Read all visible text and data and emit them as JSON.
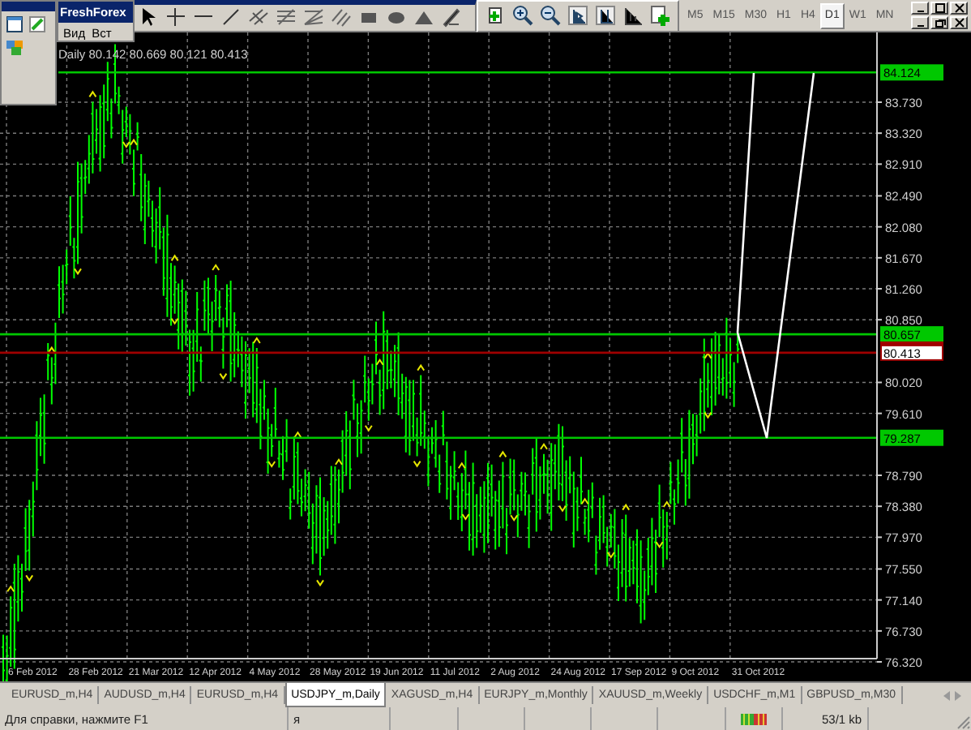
{
  "app": {
    "title": "FreshForex",
    "menu": [
      "Вид",
      "Вст"
    ]
  },
  "timeframes": [
    {
      "label": "M5",
      "selected": false
    },
    {
      "label": "M15",
      "selected": false
    },
    {
      "label": "M30",
      "selected": false
    },
    {
      "label": "H1",
      "selected": false
    },
    {
      "label": "H4",
      "selected": false
    },
    {
      "label": "D1",
      "selected": true
    },
    {
      "label": "W1",
      "selected": false
    },
    {
      "label": "MN",
      "selected": false
    }
  ],
  "chart": {
    "ohlc_text": "Daily 80.142 80.669 80.121 80.413",
    "price_ticks": [
      "83.730",
      "83.320",
      "82.910",
      "82.490",
      "82.080",
      "81.670",
      "81.260",
      "80.850",
      "80.020",
      "79.610",
      "78.790",
      "78.380",
      "77.970",
      "77.550",
      "77.140",
      "76.730",
      "76.320"
    ],
    "levels": [
      {
        "label": "84.124",
        "kind": "level",
        "color": "#00c800"
      },
      {
        "label": "80.657",
        "kind": "level",
        "color": "#00c800"
      },
      {
        "label": "80.413",
        "kind": "bid",
        "color": "#a00000"
      },
      {
        "label": "79.287",
        "kind": "level",
        "color": "#00c800"
      }
    ],
    "dates": [
      "6 Feb 2012",
      "28 Feb 2012",
      "21 Mar 2012",
      "12 Apr 2012",
      "4 May 2012",
      "28 May 2012",
      "19 Jun 2012",
      "11 Jul 2012",
      "2 Aug 2012",
      "24 Aug 2012",
      "17 Sep 2012",
      "9 Oct 2012",
      "31 Oct 2012"
    ]
  },
  "tabs": [
    {
      "label": "EURUSD_m,H4",
      "selected": false
    },
    {
      "label": "AUDUSD_m,H4",
      "selected": false
    },
    {
      "label": "EURUSD_m,H4",
      "selected": false
    },
    {
      "label": "USDJPY_m,Daily",
      "selected": true
    },
    {
      "label": "XAGUSD_m,H4",
      "selected": false
    },
    {
      "label": "EURJPY_m,Monthly",
      "selected": false
    },
    {
      "label": "XAUUSD_m,Weekly",
      "selected": false
    },
    {
      "label": "USDCHF_m,M1",
      "selected": false
    },
    {
      "label": "GBPUSD_m,M30",
      "selected": false
    }
  ],
  "status_bar": {
    "help": "Для справки, нажмите F1",
    "profile": "я",
    "traffic": "53/1 kb"
  }
}
